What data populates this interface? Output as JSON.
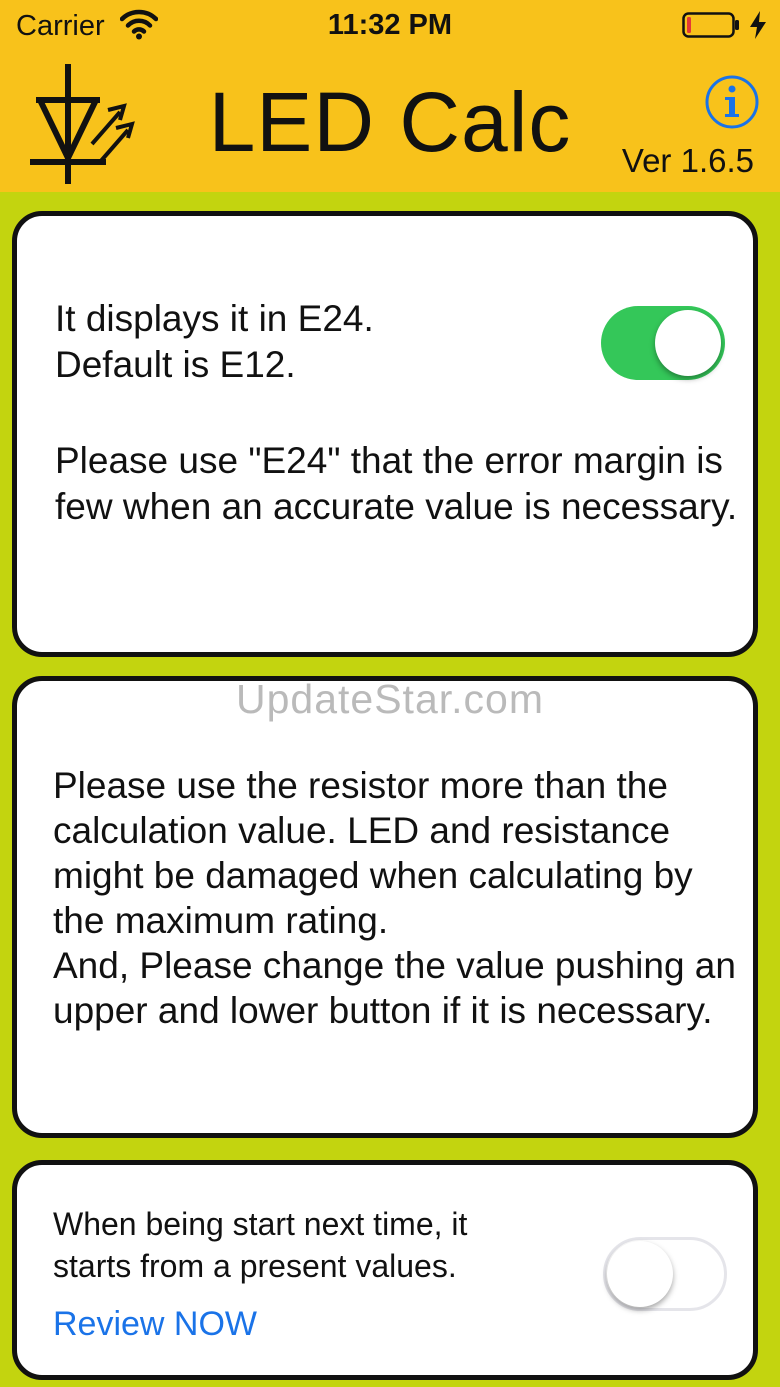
{
  "status_bar": {
    "carrier": "Carrier",
    "time": "11:32 PM",
    "icons": [
      "wifi-icon",
      "battery-icon",
      "charging-bolt-icon"
    ],
    "battery_color": "#e53935"
  },
  "header": {
    "title": "LED Calc",
    "version": "Ver 1.6.5",
    "logo_icon": "led-diode-icon",
    "info_icon": "info-icon",
    "background": "#f8c21b"
  },
  "cards": [
    {
      "primary_text": "It displays it in E24.\nDefault is E12.",
      "secondary_text": "Please use \"E24\" that the error margin is few when an accurate value is necessary.",
      "toggle_on": true
    },
    {
      "text": "Please use the resistor more than the calculation value. LED and resistance might be damaged when calculating by the maximum rating.\nAnd, Please change the value pushing an upper and lower button if it is necessary."
    },
    {
      "text": "When being start next time, it\nstarts from a present values.",
      "link": "Review NOW",
      "toggle_on": false
    }
  ],
  "watermark": "UpdateStar.com",
  "colors": {
    "page_background": "#c3d40f",
    "toggle_on": "#34c759",
    "link": "#1a73e8"
  }
}
